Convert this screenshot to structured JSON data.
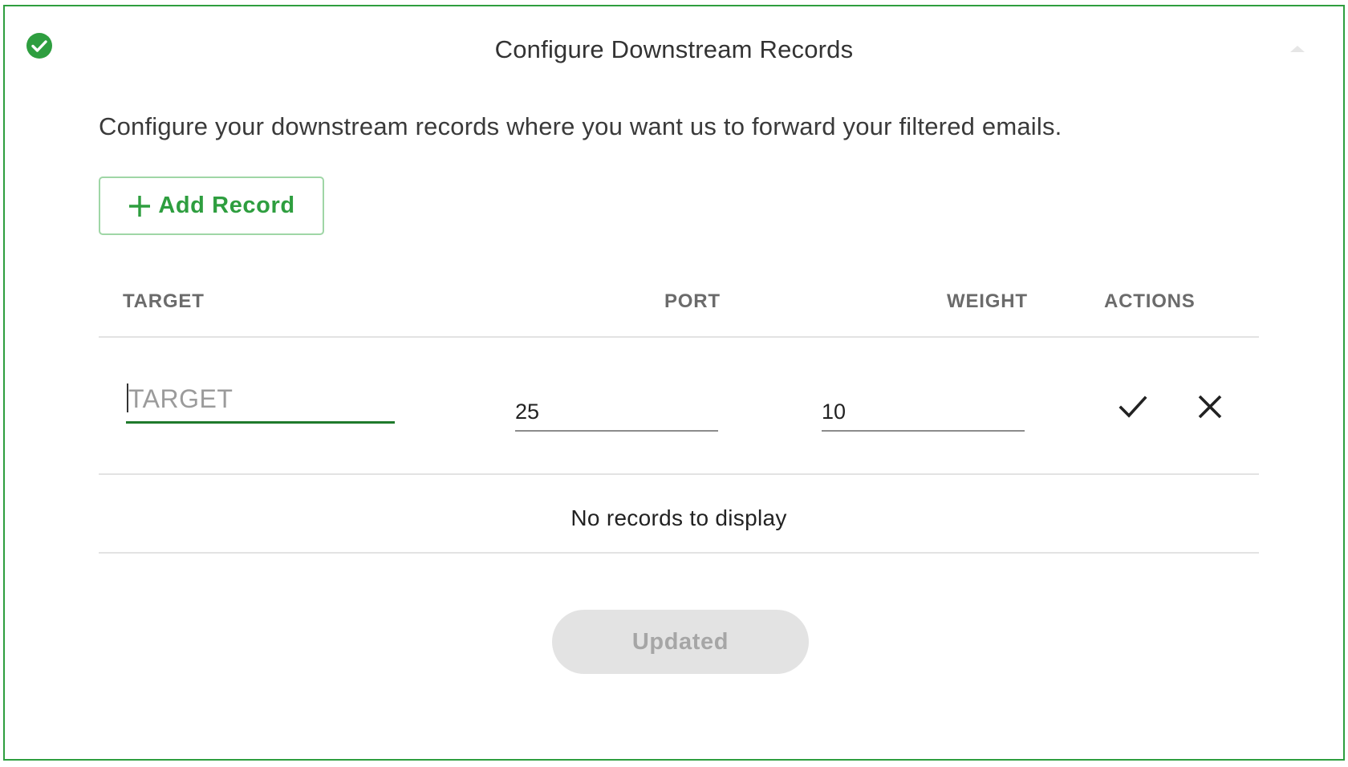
{
  "header": {
    "title": "Configure Downstream Records",
    "status_icon": "check-circle-icon",
    "collapse_icon": "chevron-up-icon"
  },
  "description": "Configure your downstream records where you want us to forward your filtered emails.",
  "toolbar": {
    "add_label": "Add Record",
    "add_icon": "plus-icon"
  },
  "table": {
    "columns": [
      "TARGET",
      "PORT",
      "WEIGHT",
      "ACTIONS"
    ],
    "edit_row": {
      "target_value": "",
      "target_placeholder": "TARGET",
      "port_value": "25",
      "weight_value": "10",
      "confirm_icon": "check-icon",
      "cancel_icon": "close-icon"
    },
    "empty_message": "No records to display"
  },
  "footer": {
    "submit_label": "Updated"
  },
  "colors": {
    "accent": "#2e9e3f",
    "accent_dark": "#1f7a2c",
    "disabled_bg": "#e3e3e3",
    "disabled_text": "#a6a6a6"
  }
}
